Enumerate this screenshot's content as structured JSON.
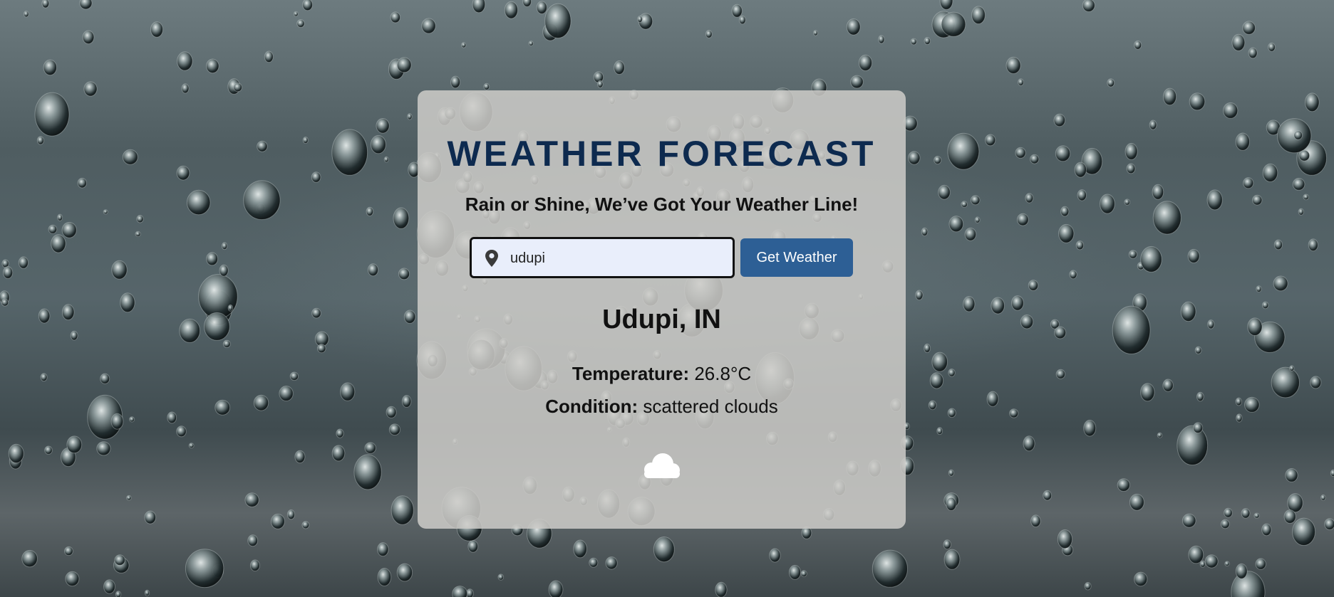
{
  "app": {
    "title": "WEATHER FORECAST",
    "tagline": "Rain or Shine, We’ve Got Your Weather Line!"
  },
  "search": {
    "icon": "map-pin-icon",
    "value": "udupi",
    "button_label": "Get Weather"
  },
  "result": {
    "city": "Udupi, IN",
    "temperature_label": "Temperature:",
    "temperature_value": "26.8°C",
    "condition_label": "Condition:",
    "condition_value": "scattered clouds",
    "icon": "cloud-icon"
  },
  "colors": {
    "title": "#0d2a4f",
    "button": "#2d5f95",
    "input_bg": "#e9eefb",
    "card_bg": "#cdccc8"
  }
}
